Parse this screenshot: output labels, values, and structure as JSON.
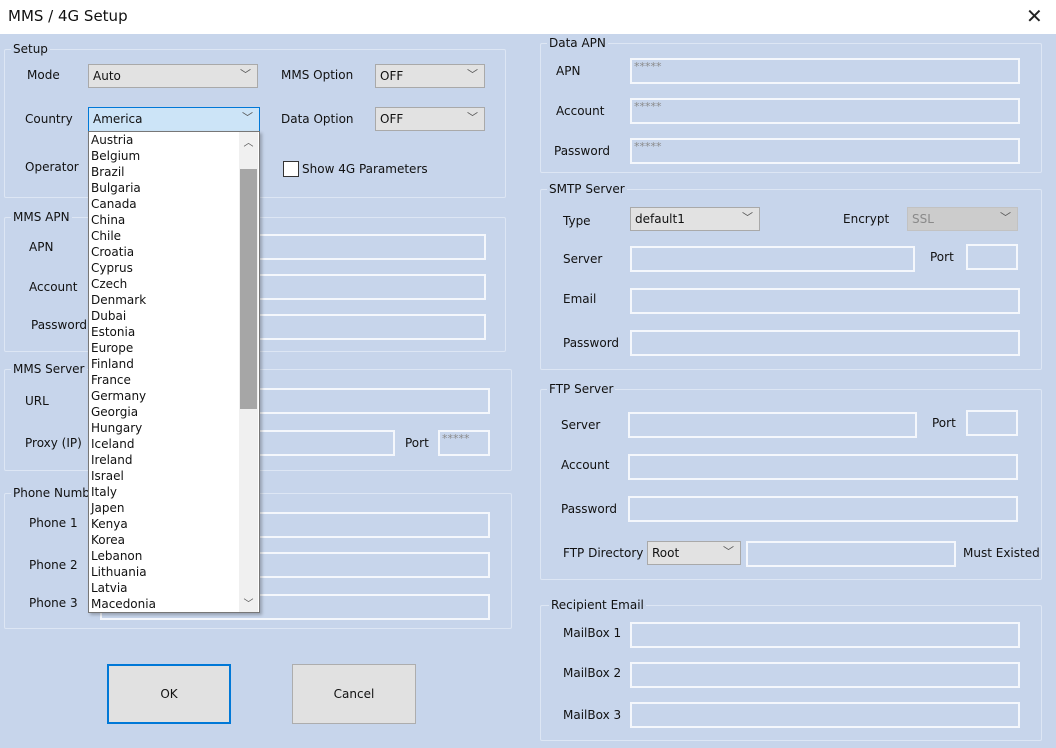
{
  "window": {
    "title": "MMS / 4G Setup",
    "close": "✕"
  },
  "setup": {
    "legend": "Setup",
    "mode_label": "Mode",
    "mode_value": "Auto",
    "mms_option_label": "MMS Option",
    "mms_option_value": "OFF",
    "country_label": "Country",
    "country_value": "America",
    "data_option_label": "Data Option",
    "data_option_value": "OFF",
    "operator_label": "Operator",
    "show4g_label": "Show 4G Parameters"
  },
  "country_options": [
    "Austria",
    "Belgium",
    "Brazil",
    "Bulgaria",
    "Canada",
    "China",
    "Chile",
    "Croatia",
    "Cyprus",
    "Czech",
    "Denmark",
    "Dubai",
    "Estonia",
    "Europe",
    "Finland",
    "France",
    "Germany",
    "Georgia",
    "Hungary",
    "Iceland",
    "Ireland",
    "Israel",
    "Italy",
    "Japen",
    "Kenya",
    "Korea",
    "Lebanon",
    "Lithuania",
    "Latvia",
    "Macedonia"
  ],
  "mms_apn": {
    "legend": "MMS APN",
    "apn_label": "APN",
    "account_label": "Account",
    "password_label": "Password"
  },
  "mms_server": {
    "legend": "MMS Server",
    "url_label": "URL",
    "proxy_label": "Proxy (IP)",
    "port_label": "Port",
    "port_value": "*****"
  },
  "phone": {
    "legend": "Phone Number",
    "phone1_label": "Phone 1",
    "phone2_label": "Phone 2",
    "phone3_label": "Phone 3"
  },
  "buttons": {
    "ok": "OK",
    "cancel": "Cancel"
  },
  "data_apn": {
    "legend": "Data APN",
    "apn_label": "APN",
    "apn_value": "*****",
    "account_label": "Account",
    "account_value": "*****",
    "password_label": "Password",
    "password_value": "*****"
  },
  "smtp": {
    "legend": "SMTP Server",
    "type_label": "Type",
    "type_value": "default1",
    "encrypt_label": "Encrypt",
    "encrypt_value": "SSL",
    "server_label": "Server",
    "port_label": "Port",
    "email_label": "Email",
    "password_label": "Password"
  },
  "ftp": {
    "legend": "FTP Server",
    "server_label": "Server",
    "port_label": "Port",
    "account_label": "Account",
    "password_label": "Password",
    "dir_label": "FTP Directory",
    "dir_value": "Root",
    "must_existed": "Must Existed"
  },
  "recipient": {
    "legend": "Recipient Email",
    "mailbox1_label": "MailBox 1",
    "mailbox2_label": "MailBox 2",
    "mailbox3_label": "MailBox 3"
  }
}
